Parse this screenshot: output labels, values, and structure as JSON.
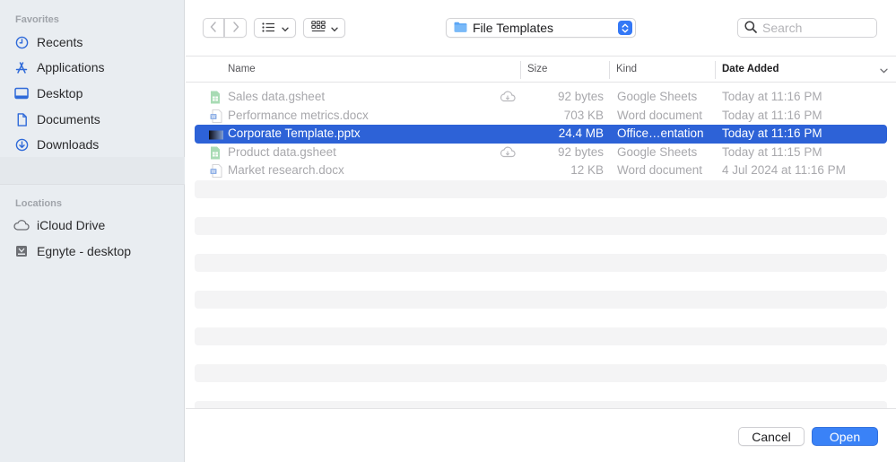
{
  "sidebar": {
    "favorites_heading": "Favorites",
    "favorites": [
      {
        "label": "Recents",
        "icon": "clock-icon"
      },
      {
        "label": "Applications",
        "icon": "applications-icon"
      },
      {
        "label": "Desktop",
        "icon": "desktop-icon"
      },
      {
        "label": "Documents",
        "icon": "document-icon"
      },
      {
        "label": "Downloads",
        "icon": "download-icon"
      }
    ],
    "locations_heading": "Locations",
    "locations": [
      {
        "label": "iCloud Drive",
        "icon": "cloud-icon"
      },
      {
        "label": "Egnyte - desktop",
        "icon": "drive-icon"
      }
    ]
  },
  "toolbar": {
    "back_icon": "chevron-left-icon",
    "forward_icon": "chevron-right-icon",
    "list_view_icon": "list-view-icon",
    "grid_view_icon": "grid-view-icon",
    "location": "File Templates",
    "search_placeholder": "Search"
  },
  "columns": {
    "name": "Name",
    "size": "Size",
    "kind": "Kind",
    "date": "Date Added"
  },
  "files": [
    {
      "name": "Sales data.gsheet",
      "size": "92 bytes",
      "kind": "Google Sheets",
      "date": "Today at 11:16 PM",
      "icon": "sheet-icon",
      "cloud": true,
      "selected": false
    },
    {
      "name": "Performance metrics.docx",
      "size": "703 KB",
      "kind": "Word document",
      "date": "Today at 11:16 PM",
      "icon": "word-icon",
      "cloud": false,
      "selected": false
    },
    {
      "name": "Corporate Template.pptx",
      "size": "24.4 MB",
      "kind": "Office…entation",
      "date": "Today at 11:16 PM",
      "icon": "pptx-icon",
      "cloud": false,
      "selected": true
    },
    {
      "name": "Product data.gsheet",
      "size": "92 bytes",
      "kind": "Google Sheets",
      "date": "Today at 11:15 PM",
      "icon": "sheet-icon",
      "cloud": true,
      "selected": false
    },
    {
      "name": "Market research.docx",
      "size": "12 KB",
      "kind": "Word document",
      "date": "4 Jul 2024 at 11:16 PM",
      "icon": "word-icon",
      "cloud": false,
      "selected": false
    }
  ],
  "footer": {
    "cancel_label": "Cancel",
    "open_label": "Open"
  },
  "colors": {
    "accent": "#3a82f7",
    "selection": "#2d62d7",
    "sidebar_icon": "#2f6ad9",
    "sheet_green": "#34a853"
  }
}
